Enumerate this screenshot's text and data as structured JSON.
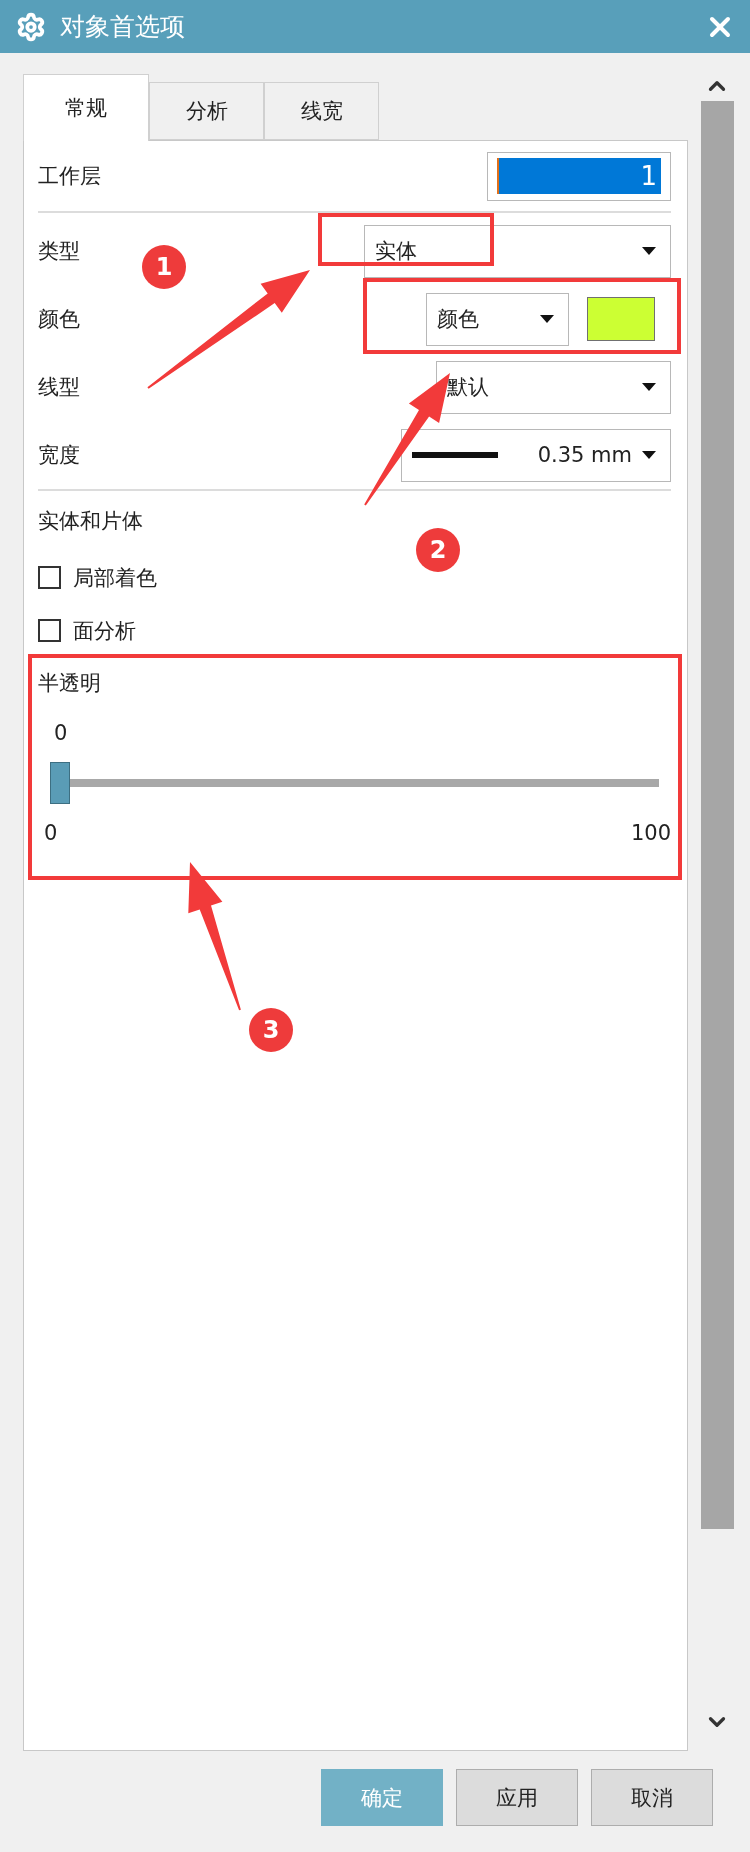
{
  "window": {
    "title": "对象首选项"
  },
  "tabs": [
    {
      "label": "常规",
      "selected": true
    },
    {
      "label": "分析",
      "selected": false
    },
    {
      "label": "线宽",
      "selected": false
    }
  ],
  "work_layer": {
    "label": "工作层",
    "value": "1",
    "selected": true
  },
  "properties": [
    {
      "kind": "dropdown",
      "label": "类型",
      "value": "实体"
    },
    {
      "kind": "color",
      "label": "颜色",
      "value": "颜色",
      "color": "#ccff33"
    },
    {
      "kind": "dropdown",
      "label": "线型",
      "value": "默认"
    },
    {
      "kind": "width",
      "label": "宽度",
      "value": "0.35 mm"
    }
  ],
  "solids_section": {
    "title": "实体和片体",
    "checkboxes": [
      {
        "label": "局部着色",
        "checked": false
      },
      {
        "label": "面分析",
        "checked": false
      }
    ]
  },
  "translucency": {
    "title": "半透明",
    "reading": "0",
    "level": 0,
    "min_label": "0",
    "max_label": "100"
  },
  "buttons": [
    {
      "label": "确定",
      "kind": "primary"
    },
    {
      "label": "应用",
      "kind": "normal"
    },
    {
      "label": "取消",
      "kind": "normal"
    }
  ],
  "annotations": [
    {
      "label": "1"
    },
    {
      "label": "2"
    },
    {
      "label": "3"
    }
  ]
}
